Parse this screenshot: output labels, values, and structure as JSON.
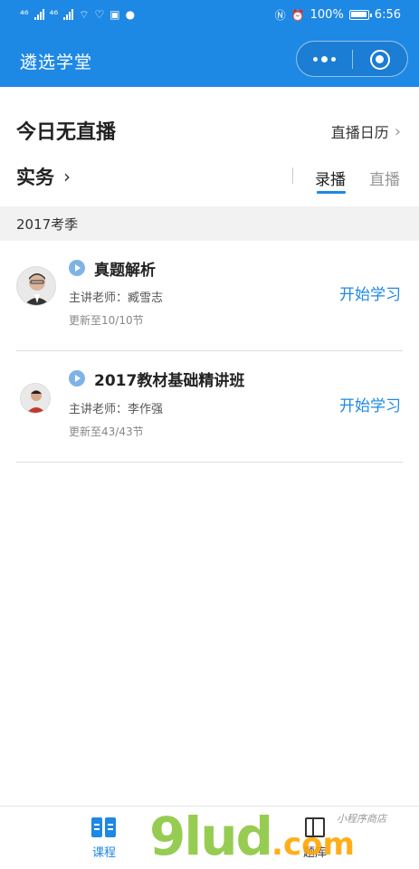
{
  "status_bar": {
    "left_glyphs": [
      "⁴⁶",
      "⁴⁶"
    ],
    "battery": "100%",
    "time": "6:56"
  },
  "nav": {
    "title": "遴选学堂"
  },
  "live": {
    "status": "今日无直播",
    "calendar_link": "直播日历"
  },
  "subject": {
    "name": "实务",
    "tabs": [
      {
        "label": "录播",
        "active": true
      },
      {
        "label": "直播",
        "active": false
      }
    ]
  },
  "season": "2017考季",
  "courses": [
    {
      "title": "真题解析",
      "teacher": "主讲老师：臧雪志",
      "progress": "更新至10/10节",
      "action": "开始学习"
    },
    {
      "title": "2017教材基础精讲班",
      "teacher": "主讲老师：李作强",
      "progress": "更新至43/43节",
      "action": "开始学习"
    }
  ],
  "tabbar": {
    "items": [
      {
        "label": "课程",
        "active": true
      },
      {
        "label": "题库",
        "active": false
      }
    ]
  },
  "watermark": {
    "main": "9lud",
    "dot": ".com",
    "side": "小程序商店"
  },
  "colors": {
    "brand": "#1e88e5",
    "season_bg": "#f2f2f2"
  }
}
